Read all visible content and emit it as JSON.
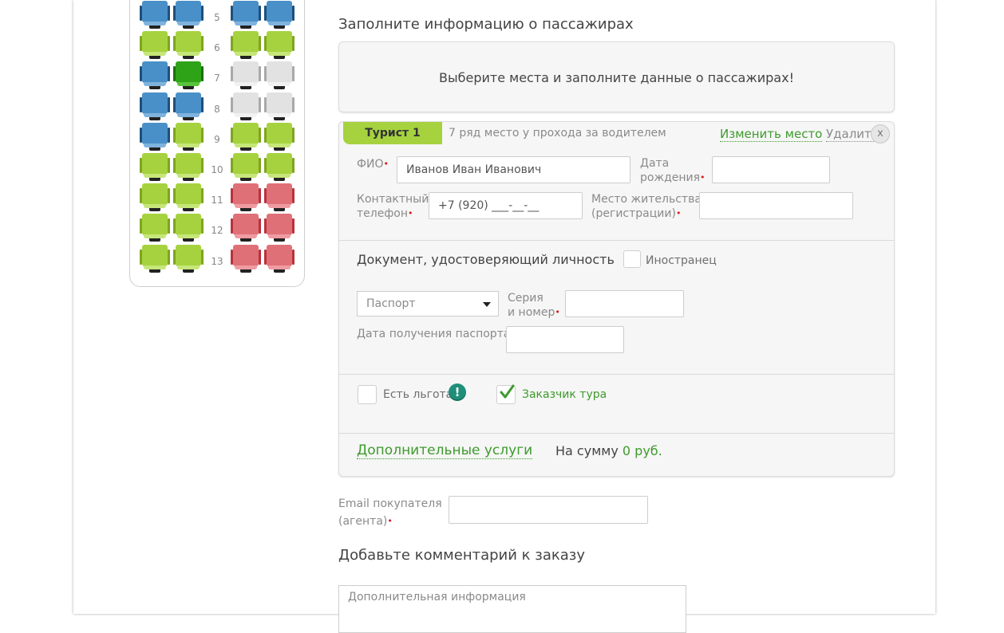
{
  "colors": {
    "seat_blue": "#4a90c8",
    "seat_lightgreen": "#a6d23f",
    "seat_green": "#2ea317",
    "seat_grey": "#e2e2e2",
    "seat_red": "#e07078",
    "accent_green": "#3f9a2e",
    "required_red": "#d61b1b"
  },
  "seatmap": {
    "rows": [
      {
        "num": "5",
        "seats": [
          "blue",
          "blue",
          "blue",
          "blue"
        ]
      },
      {
        "num": "6",
        "seats": [
          "lightgreen",
          "lightgreen",
          "lightgreen",
          "lightgreen"
        ]
      },
      {
        "num": "7",
        "seats": [
          "blue",
          "green",
          "grey",
          "grey"
        ]
      },
      {
        "num": "8",
        "seats": [
          "blue",
          "blue",
          "grey",
          "grey"
        ]
      },
      {
        "num": "9",
        "seats": [
          "blue",
          "lightgreen",
          "lightgreen",
          "lightgreen"
        ]
      },
      {
        "num": "10",
        "seats": [
          "lightgreen",
          "lightgreen",
          "lightgreen",
          "lightgreen"
        ]
      },
      {
        "num": "11",
        "seats": [
          "lightgreen",
          "lightgreen",
          "red",
          "red"
        ]
      },
      {
        "num": "12",
        "seats": [
          "lightgreen",
          "lightgreen",
          "red",
          "red"
        ]
      },
      {
        "num": "13",
        "seats": [
          "lightgreen",
          "lightgreen",
          "red",
          "red"
        ]
      }
    ]
  },
  "form": {
    "title": "Заполните информацию о пассажирах",
    "notice": "Выберите места и заполните данные о пассажирах!",
    "passenger": {
      "tab_label": "Турист 1",
      "seat_info": "7 ряд место у прохода за водителем",
      "change_seat": "Изменить место",
      "delete": "Удалить",
      "close": "x",
      "fio_label": "ФИО",
      "fio_value": "Иванов Иван Иванович",
      "dob_label_1": "Дата",
      "dob_label_2": "рождения",
      "dob_value": "",
      "phone_label_1": "Контактный",
      "phone_label_2": "телефон",
      "phone_value": "+7 (920) ___-__-__",
      "residence_label_1": "Место жительства",
      "residence_label_2": "(регистрации)",
      "residence_value": "",
      "doc_title": "Документ, удостоверяющий личность",
      "foreigner": "Иностранец",
      "doc_type": "Паспорт",
      "series_label_1": "Серия",
      "series_label_2": "и номер",
      "series_value": "",
      "issue_date_label": "Дата получения паспорта",
      "issue_date_value": "",
      "benefit": "Есть льгота",
      "benefit_info": "!",
      "customer": "Заказчик тура",
      "customer_checked": true,
      "services": "Дополнительные услуги",
      "sum_label": "На сумму",
      "sum_value": "0 руб."
    },
    "email_label_1": "Email покупателя",
    "email_label_2": "(агента)",
    "email_value": "",
    "comment_title": "Добавьте комментарий к заказу",
    "comment_placeholder": "Дополнительная информация"
  }
}
